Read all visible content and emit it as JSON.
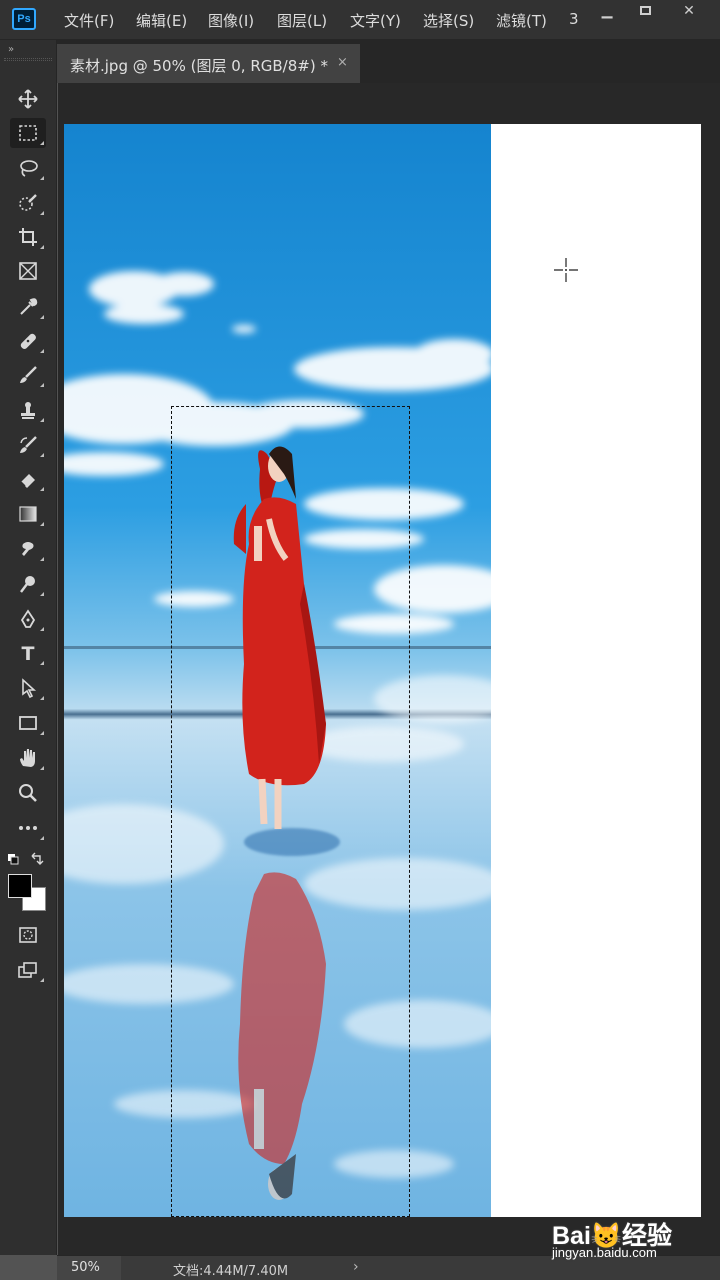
{
  "app": {
    "logo_text": "Ps",
    "menu": [
      "文件(F)",
      "编辑(E)",
      "图像(I)",
      "图层(L)",
      "文字(Y)",
      "选择(S)",
      "滤镜(T)",
      "3"
    ],
    "window_controls": {
      "minimize": "▁",
      "close": "✕"
    }
  },
  "toolbox": {
    "collapse_glyph": "»",
    "tools": [
      {
        "name": "move-tool",
        "icon": "move-icon"
      },
      {
        "name": "rectangular-marquee-tool",
        "icon": "marquee-icon",
        "active": true
      },
      {
        "name": "lasso-tool",
        "icon": "lasso-icon"
      },
      {
        "name": "quick-selection-tool",
        "icon": "quick-selection-icon"
      },
      {
        "name": "crop-tool",
        "icon": "crop-icon"
      },
      {
        "name": "frame-tool",
        "icon": "frame-icon"
      },
      {
        "name": "eyedropper-tool",
        "icon": "eyedropper-icon"
      },
      {
        "name": "healing-brush-tool",
        "icon": "bandage-icon"
      },
      {
        "name": "brush-tool",
        "icon": "brush-icon"
      },
      {
        "name": "clone-stamp-tool",
        "icon": "stamp-icon"
      },
      {
        "name": "history-brush-tool",
        "icon": "history-brush-icon"
      },
      {
        "name": "eraser-tool",
        "icon": "eraser-icon"
      },
      {
        "name": "gradient-tool",
        "icon": "gradient-icon"
      },
      {
        "name": "smudge-tool",
        "icon": "smudge-icon"
      },
      {
        "name": "dodge-tool",
        "icon": "dodge-icon"
      },
      {
        "name": "pen-tool",
        "icon": "pen-icon"
      },
      {
        "name": "type-tool",
        "icon": "type-icon",
        "label": "T"
      },
      {
        "name": "path-selection-tool",
        "icon": "arrow-icon"
      },
      {
        "name": "rectangle-tool",
        "icon": "rectangle-icon"
      },
      {
        "name": "hand-tool",
        "icon": "hand-icon"
      },
      {
        "name": "zoom-tool",
        "icon": "magnifier-icon"
      },
      {
        "name": "edit-toolbar",
        "icon": "ellipsis-icon",
        "label": "•••"
      }
    ],
    "colors": {
      "foreground": "#000000",
      "background": "#ffffff"
    }
  },
  "document": {
    "tab_title": "素材.jpg @ 50% (图层 0, RGB/8#) *",
    "tab_close": "×"
  },
  "status": {
    "zoom": "50%",
    "doc_info": "文档:4.44M/7.40M",
    "arrow": "›"
  },
  "watermark": {
    "logo": "Bai😺经验",
    "url": "jingyan.baidu.com"
  },
  "colors": {
    "accent": "#31a8ff",
    "sky_top": "#1a8fd6",
    "dress": "#d2231c"
  }
}
